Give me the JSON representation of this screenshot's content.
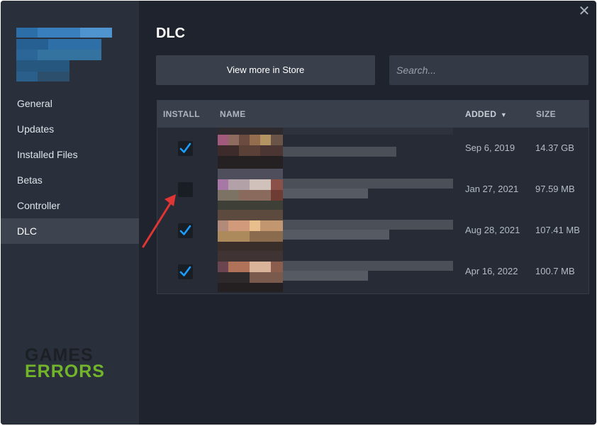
{
  "header": {
    "title": "DLC",
    "store_button": "View more in Store"
  },
  "search": {
    "placeholder": "Search..."
  },
  "sidebar": {
    "items": [
      {
        "label": "General",
        "active": false
      },
      {
        "label": "Updates",
        "active": false
      },
      {
        "label": "Installed Files",
        "active": false
      },
      {
        "label": "Betas",
        "active": false
      },
      {
        "label": "Controller",
        "active": false
      },
      {
        "label": "DLC",
        "active": true
      }
    ]
  },
  "table": {
    "columns": {
      "install": "INSTALL",
      "name": "NAME",
      "added": "ADDED",
      "size": "SIZE"
    },
    "sort_indicator": "▼",
    "rows": [
      {
        "installed": true,
        "added": "Sep 6, 2019",
        "size": "14.37 GB"
      },
      {
        "installed": false,
        "added": "Jan 27, 2021",
        "size": "97.59 MB"
      },
      {
        "installed": true,
        "added": "Aug 28, 2021",
        "size": "107.41 MB"
      },
      {
        "installed": true,
        "added": "Apr 16, 2022",
        "size": "100.7 MB"
      }
    ]
  },
  "watermark": {
    "line1": "GAMES",
    "line2": "ERRORS"
  },
  "icons": {
    "close": "close-icon",
    "checkbox": "checkmark-icon",
    "sort": "sort-desc-icon",
    "annotation": "red-arrow-icon"
  },
  "colors": {
    "accent": "#1a9fff",
    "window_bg": "#1e232d",
    "sidebar_bg": "#2a303b",
    "annotation": "#e03535",
    "watermark_green": "#73b52a"
  }
}
